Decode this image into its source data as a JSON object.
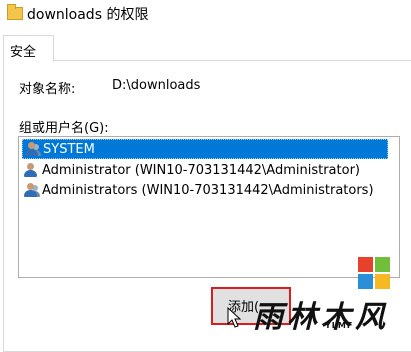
{
  "window": {
    "title": "downloads 的权限"
  },
  "tabs": [
    {
      "label": "安全"
    }
  ],
  "object": {
    "label": "对象名称:",
    "value": "D:\\downloads"
  },
  "groups": {
    "label": "组或用户名(G):",
    "items": [
      {
        "name": "SYSTEM",
        "selected": true,
        "icon": "group-users-icon"
      },
      {
        "name": "Administrator (WIN10-703131442\\Administrator)",
        "selected": false,
        "icon": "user-icon"
      },
      {
        "name": "Administrators (WIN10-703131442\\Administrators)",
        "selected": false,
        "icon": "group-users-icon"
      }
    ]
  },
  "buttons": {
    "add": "添加("
  },
  "watermark": {
    "text": "雨林木风",
    "sub": "YLMF"
  },
  "colors": {
    "selection": "#0078d7",
    "highlight_border": "#d81e1e",
    "logo_red": "#e8412b",
    "logo_green": "#6fbf3b",
    "logo_blue": "#2a8fd8",
    "logo_yellow": "#f5b923"
  }
}
